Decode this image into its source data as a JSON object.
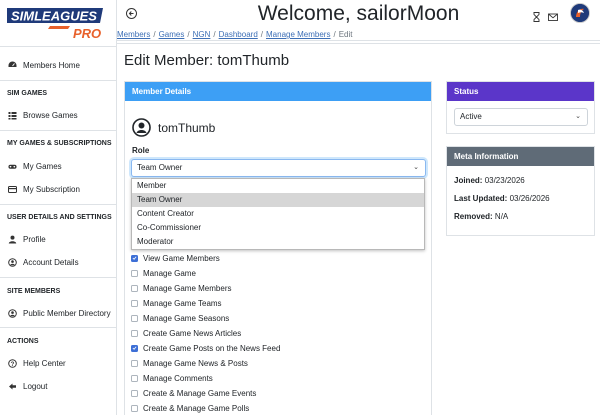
{
  "brand": {
    "logo_line1": "SIMLEAGUES",
    "logo_line2": "PRO",
    "accent_color": "#e8612b",
    "navy_color": "#1f3a7a"
  },
  "sidebar": {
    "items": [
      {
        "label": "Members Home",
        "icon": "dashboard-icon"
      }
    ],
    "sections": [
      {
        "title": "SIM GAMES",
        "items": [
          {
            "label": "Browse Games",
            "icon": "list-icon"
          }
        ]
      },
      {
        "title": "MY GAMES & SUBSCRIPTIONS",
        "items": [
          {
            "label": "My Games",
            "icon": "gamepad-icon"
          },
          {
            "label": "My Subscription",
            "icon": "card-icon"
          }
        ]
      },
      {
        "title": "USER DETAILS AND SETTINGS",
        "items": [
          {
            "label": "Profile",
            "icon": "user-icon"
          },
          {
            "label": "Account Details",
            "icon": "user-circle-icon"
          }
        ]
      },
      {
        "title": "SITE MEMBERS",
        "items": [
          {
            "label": "Public Member Directory",
            "icon": "user-circle-icon"
          }
        ]
      },
      {
        "title": "ACTIONS",
        "items": [
          {
            "label": "Help Center",
            "icon": "question-icon"
          },
          {
            "label": "Logout",
            "icon": "logout-icon"
          }
        ]
      }
    ]
  },
  "header": {
    "welcome": "Welcome, sailorMoon"
  },
  "breadcrumb": {
    "items": [
      "Members",
      "Games",
      "NGN",
      "Dashboard",
      "Manage Members"
    ],
    "current": "Edit"
  },
  "page": {
    "title": "Edit Member: tomThumb"
  },
  "member_details": {
    "header": "Member Details",
    "username": "tomThumb",
    "role_label": "Role",
    "role_value": "Team Owner",
    "role_options": [
      "Member",
      "Team Owner",
      "Content Creator",
      "Co-Commissioner",
      "Moderator"
    ],
    "permissions": [
      {
        "label": "View Game Members",
        "checked": true
      },
      {
        "label": "Manage Game",
        "checked": false
      },
      {
        "label": "Manage Game Members",
        "checked": false
      },
      {
        "label": "Manage Game Teams",
        "checked": false
      },
      {
        "label": "Manage Game Seasons",
        "checked": false
      },
      {
        "label": "Create Game News Articles",
        "checked": false
      },
      {
        "label": "Create Game Posts on the News Feed",
        "checked": true
      },
      {
        "label": "Manage Game News & Posts",
        "checked": false
      },
      {
        "label": "Manage Comments",
        "checked": false
      },
      {
        "label": "Create & Manage Game Events",
        "checked": false
      },
      {
        "label": "Create & Manage Game Polls",
        "checked": false
      }
    ]
  },
  "status": {
    "header": "Status",
    "value": "Active"
  },
  "meta": {
    "header": "Meta Information",
    "joined_label": "Joined:",
    "joined_value": "03/23/2026",
    "updated_label": "Last Updated:",
    "updated_value": "03/26/2026",
    "removed_label": "Removed:",
    "removed_value": "N/A"
  }
}
